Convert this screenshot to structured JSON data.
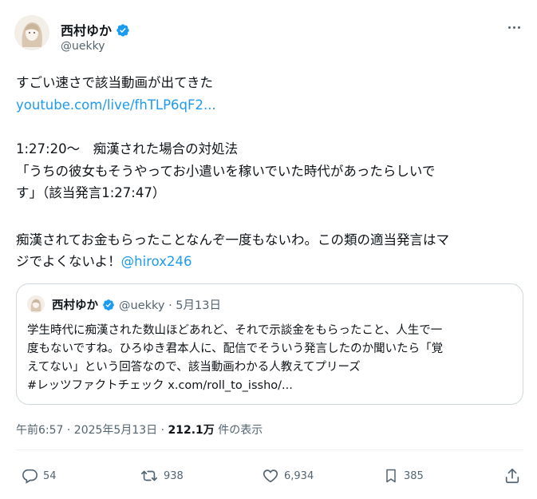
{
  "author": {
    "name": "西村ゆか",
    "handle": "@uekky"
  },
  "tweet": {
    "lines": [
      "すごい速さで該当動画が出てきた",
      "1:27:20～　痴漢された場合の対処法",
      "「うちの彼女もそうやってお小遣いを稼いでいた時代があったらしいで",
      "す」（該当発言1:27:47）",
      "痴漢されてお金もらったことなんぞ一度もないわ。この類の適当発言はマ",
      "ジでよくないよ！"
    ],
    "link": "youtube.com/live/fhTLP6qF2...",
    "mention": "@hirox246"
  },
  "quote": {
    "name": "西村ゆか",
    "handle_date": "@uekky · 5月13日",
    "lines": [
      "学生時代に痴漢された数山ほどあれど、それで示談金をもらったこと、人生で一",
      "度もないですね。ひろゆき君本人に、配信でそういう発言したのか聞いたら「覚",
      "えてない」という回答なので、該当動画わかる人教えてプリーズ"
    ],
    "hashtag": "#レッツファクトチェック",
    "link": "x.com/roll_to_issho/..."
  },
  "meta": {
    "time_date": "午前6:57 · 2025年5月13日 · ",
    "views": "212.1万",
    "views_label": " 件の表示"
  },
  "actions": {
    "replies": "54",
    "reposts": "938",
    "likes": "6,934",
    "bookmarks": "385"
  },
  "colors": {
    "accent": "#1d9bf0",
    "text": "#0f1419",
    "secondary": "#536471",
    "border": "#cfd9de"
  }
}
